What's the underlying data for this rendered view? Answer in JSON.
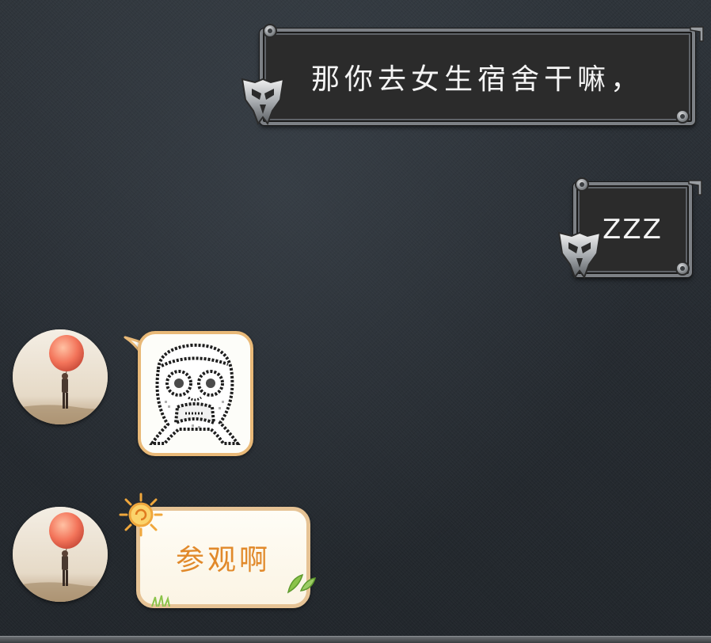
{
  "chat": {
    "messages": [
      {
        "direction": "outgoing",
        "type": "text",
        "text": "那你去女生宿舍干嘛，"
      },
      {
        "direction": "outgoing",
        "type": "text",
        "text": "ZZZ"
      },
      {
        "direction": "incoming",
        "type": "sticker",
        "sticker": "rage-face-sticker"
      },
      {
        "direction": "incoming",
        "type": "text",
        "text": "参观啊"
      }
    ]
  },
  "theme": {
    "background": "#2a2f34",
    "outgoing_bubble": "#2b2b2b",
    "outgoing_text": "#f4f4f4",
    "incoming_bubble": "#fdfaf0",
    "incoming_border": "#e6c395",
    "incoming_text": "#e1892a"
  },
  "icons": {
    "outgoing_badge": "decepticon-icon",
    "sun_decoration": "sun-icon",
    "leaf_decoration": "leaf-icon"
  }
}
